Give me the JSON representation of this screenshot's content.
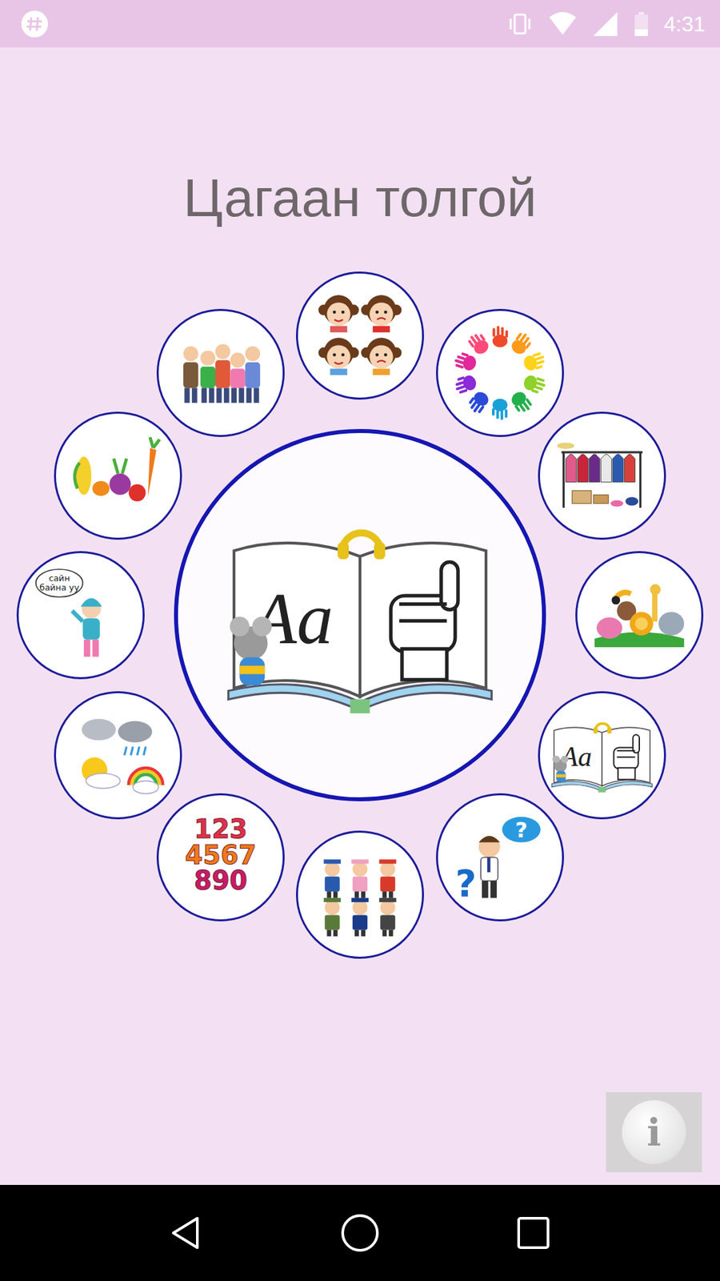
{
  "status_bar": {
    "time": "4:31"
  },
  "title": "Цагаан толгой",
  "center": {
    "letters": "Aa"
  },
  "menu": [
    {
      "kind": "colors"
    },
    {
      "kind": "clothes"
    },
    {
      "kind": "animals"
    },
    {
      "kind": "alphabet",
      "text": "Aa"
    },
    {
      "kind": "question",
      "text": "?"
    },
    {
      "kind": "professions"
    },
    {
      "kind": "numbers",
      "rows": [
        "123",
        "4567",
        "890"
      ]
    },
    {
      "kind": "weather"
    },
    {
      "kind": "greeting",
      "lines": [
        "сайн",
        "байна уу"
      ]
    },
    {
      "kind": "vegetables"
    },
    {
      "kind": "family"
    },
    {
      "kind": "emotions"
    }
  ],
  "info_button": {
    "text": "i"
  }
}
